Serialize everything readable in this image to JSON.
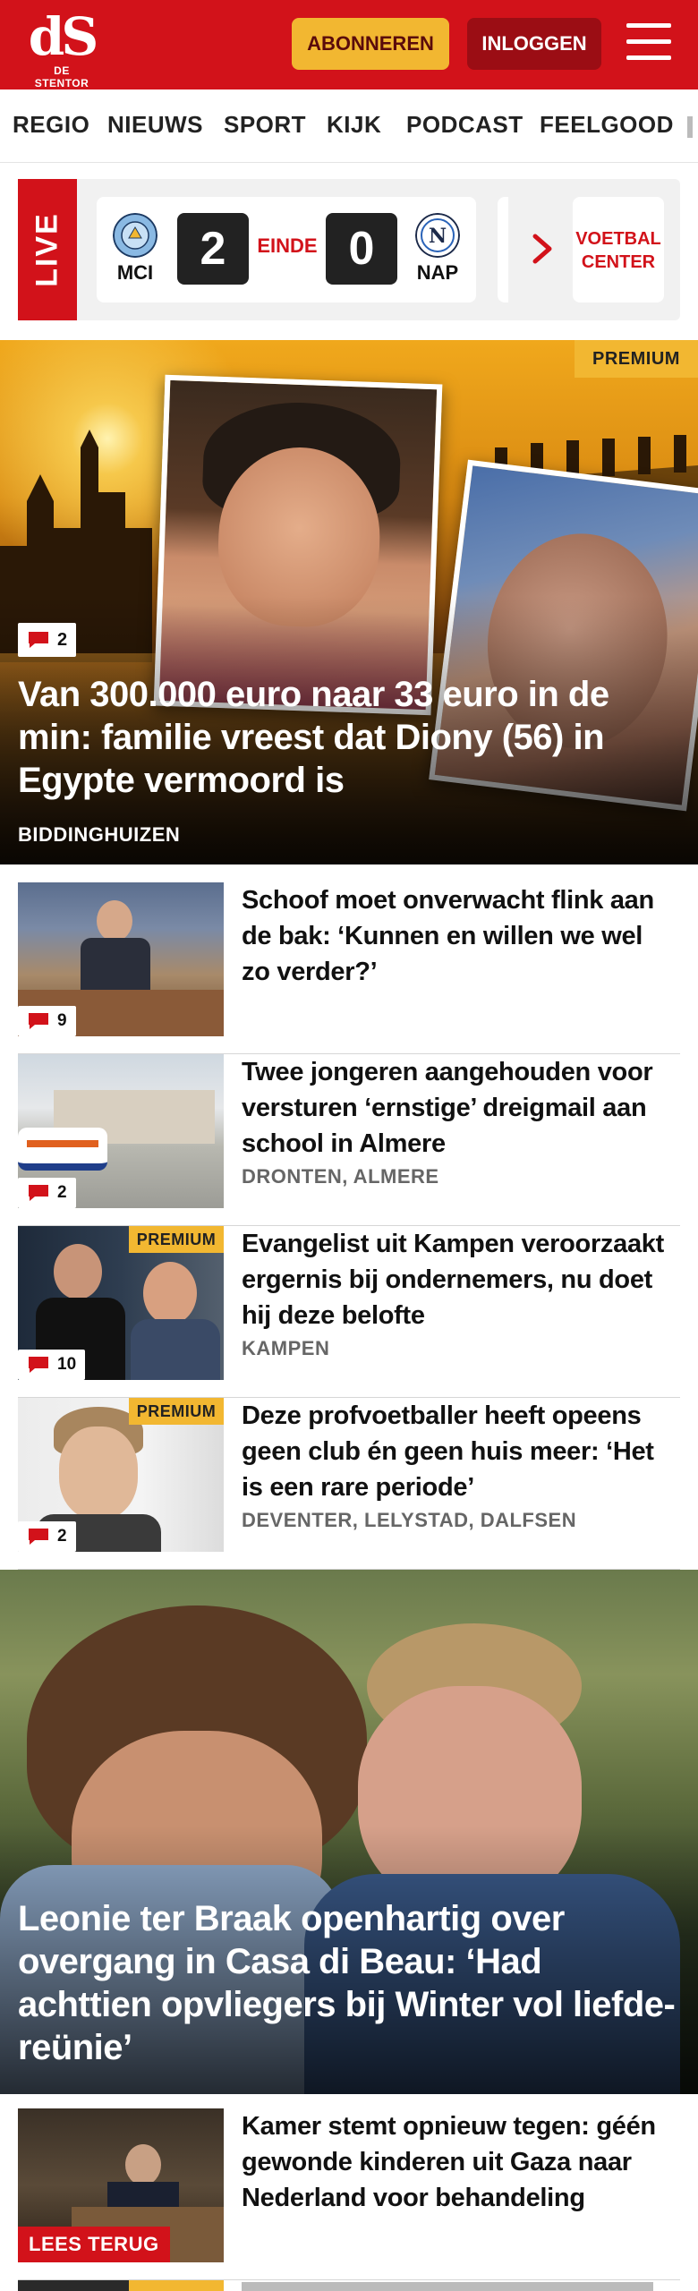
{
  "header": {
    "logo_mark": "dS",
    "logo_sub": "DE STENTOR",
    "subscribe_label": "ABONNEREN",
    "login_label": "INLOGGEN",
    "brand_color": "#d2121a"
  },
  "nav": {
    "items": [
      "REGIO",
      "NIEUWS",
      "SPORT",
      "KIJK",
      "PODCAST",
      "FEELGOOD"
    ]
  },
  "live": {
    "label": "LIVE",
    "match": {
      "home": "MCI",
      "away": "NAP",
      "home_score": "2",
      "away_score": "0",
      "status": "EINDE"
    },
    "voetbal_center": "VOETBAL CENTER"
  },
  "hero1": {
    "premium": "PREMIUM",
    "comments": "2",
    "title": "Van 300.000 euro naar 33 euro in de min: familie vreest dat Diony (56) in Egypte vermoord is",
    "location": "BIDDINGHUIZEN"
  },
  "articles": [
    {
      "title": "Schoof moet onverwacht flink aan de bak: ‘Kunnen en willen we wel zo verder?’",
      "comments": "9",
      "location": "",
      "premium": ""
    },
    {
      "title": "Twee jongeren aangehouden voor versturen ‘ernstige’ dreigmail aan school in Almere",
      "comments": "2",
      "location": "DRONTEN, ALMERE",
      "premium": ""
    },
    {
      "title": "Evangelist uit Kampen veroor­zaakt ergernis bij ondernemers, nu doet hij deze belofte",
      "comments": "10",
      "location": "KAMPEN",
      "premium": "PREMIUM"
    },
    {
      "title": "Deze profvoetballer heeft opeens geen club én geen huis meer: ‘Het is een rare periode’",
      "comments": "2",
      "location": "DEVENTER, LELYSTAD, DALFSEN",
      "premium": "PREMIUM"
    }
  ],
  "hero2": {
    "title": "Leonie ter Braak openhartig over overgang in Casa di Beau: ‘Had achttien opvliegers bij Winter vol lief­de-reünie’"
  },
  "article_bottom": {
    "title": "Kamer stemt opnieuw tegen: géén gewonde kinderen uit Gaza naar Nederland voor behandeling",
    "tag": "LEES TERUG"
  },
  "article_peek": {
    "premium": "PREMIUM"
  },
  "icons": {
    "menu": "hamburger-menu-icon",
    "comment": "comment-bubble-icon",
    "chevron": "chevron-right-icon"
  }
}
